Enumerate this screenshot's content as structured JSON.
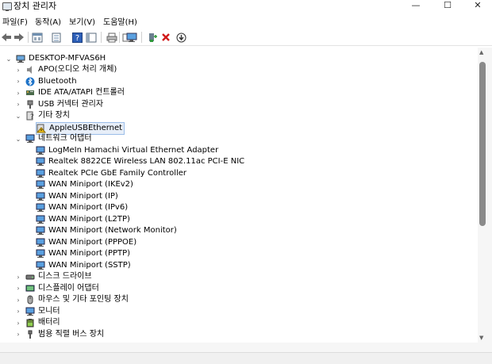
{
  "window": {
    "title": "장치 관리자",
    "minimize": "—",
    "maximize": "☐",
    "close": "✕"
  },
  "menu": [
    "파일(F)",
    "동작(A)",
    "보기(V)",
    "도움말(H)"
  ],
  "toolbar": [
    "back-icon",
    "forward-icon",
    "properties-view-icon",
    "details-icon",
    "help-icon",
    "toggle-view-icon",
    "print-icon",
    "refresh-icon",
    "monitor-icon",
    "add-driver-icon",
    "uninstall-icon",
    "download-icon"
  ],
  "tree": {
    "computer": "DESKTOP-MFVAS6H",
    "categories": [
      {
        "label": "APO(오디오 처리 개체)",
        "icon": "speaker-icon",
        "expanded": false
      },
      {
        "label": "Bluetooth",
        "icon": "bluetooth-icon",
        "expanded": false
      },
      {
        "label": "IDE ATA/ATAPI 컨트롤러",
        "icon": "ide-controller-icon",
        "expanded": false
      },
      {
        "label": "USB 커넥터 관리자",
        "icon": "usb-icon",
        "expanded": false
      },
      {
        "label": "기타 장치",
        "icon": "other-device-icon",
        "expanded": true
      },
      {
        "label": "AppleUSBEthernet",
        "icon": "warning-device-icon",
        "child": true,
        "selected": true
      },
      {
        "label": "네트워크 어댑터",
        "icon": "network-icon",
        "expanded": true
      },
      {
        "label": "LogMeIn Hamachi Virtual Ethernet Adapter",
        "icon": "network-adapter-icon",
        "child": true
      },
      {
        "label": "Realtek 8822CE Wireless LAN 802.11ac PCI-E NIC",
        "icon": "network-adapter-icon",
        "child": true
      },
      {
        "label": "Realtek PCIe GbE Family Controller",
        "icon": "network-adapter-icon",
        "child": true
      },
      {
        "label": "WAN Miniport (IKEv2)",
        "icon": "network-adapter-icon",
        "child": true
      },
      {
        "label": "WAN Miniport (IP)",
        "icon": "network-adapter-icon",
        "child": true
      },
      {
        "label": "WAN Miniport (IPv6)",
        "icon": "network-adapter-icon",
        "child": true
      },
      {
        "label": "WAN Miniport (L2TP)",
        "icon": "network-adapter-icon",
        "child": true
      },
      {
        "label": "WAN Miniport (Network Monitor)",
        "icon": "network-adapter-icon",
        "child": true
      },
      {
        "label": "WAN Miniport (PPPOE)",
        "icon": "network-adapter-icon",
        "child": true
      },
      {
        "label": "WAN Miniport (PPTP)",
        "icon": "network-adapter-icon",
        "child": true
      },
      {
        "label": "WAN Miniport (SSTP)",
        "icon": "network-adapter-icon",
        "child": true
      },
      {
        "label": "디스크 드라이브",
        "icon": "disk-icon",
        "expanded": false
      },
      {
        "label": "디스플레이 어댑터",
        "icon": "display-icon",
        "expanded": false
      },
      {
        "label": "마우스 및 기타 포인팅 장치",
        "icon": "mouse-icon",
        "expanded": false
      },
      {
        "label": "모니터",
        "icon": "monitor-icon",
        "expanded": false
      },
      {
        "label": "배터리",
        "icon": "battery-icon",
        "expanded": false
      },
      {
        "label": "범용 직렬 버스 장치",
        "icon": "usb-device-icon",
        "expanded": false
      }
    ]
  },
  "colors": {
    "accent": "#1e73c8",
    "selection": "#e7eef8",
    "warning": "#f2c21b",
    "error": "#d11a1a"
  }
}
